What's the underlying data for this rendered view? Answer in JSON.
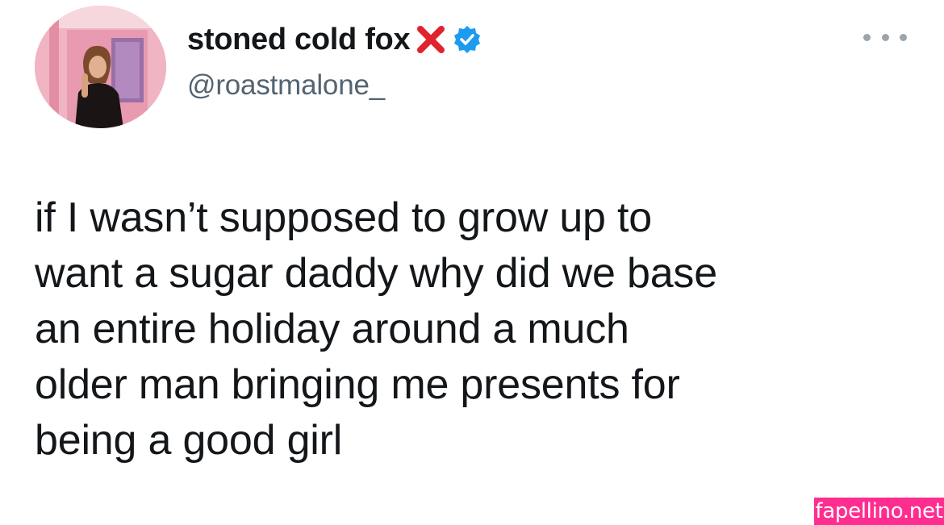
{
  "tweet": {
    "author": {
      "display_name": "stoned cold fox",
      "handle": "@roastmalone_",
      "badges": [
        "cross-mark-emoji",
        "verified-badge-icon"
      ],
      "avatar_icon": "profile-photo"
    },
    "more_icon": "more-options-icon",
    "text_lines": [
      "if I wasn’t supposed to grow up to",
      "want a sugar daddy why did we base",
      "an entire holiday around a much",
      "older man bringing me presents for",
      "being a good girl"
    ]
  },
  "watermark": {
    "text": "fapellino.net"
  },
  "colors": {
    "verified": "#1d9bf0",
    "cross": "#e0242e",
    "text": "#14171a",
    "handle": "#536471",
    "watermark_bg": "#ff2d8f"
  }
}
